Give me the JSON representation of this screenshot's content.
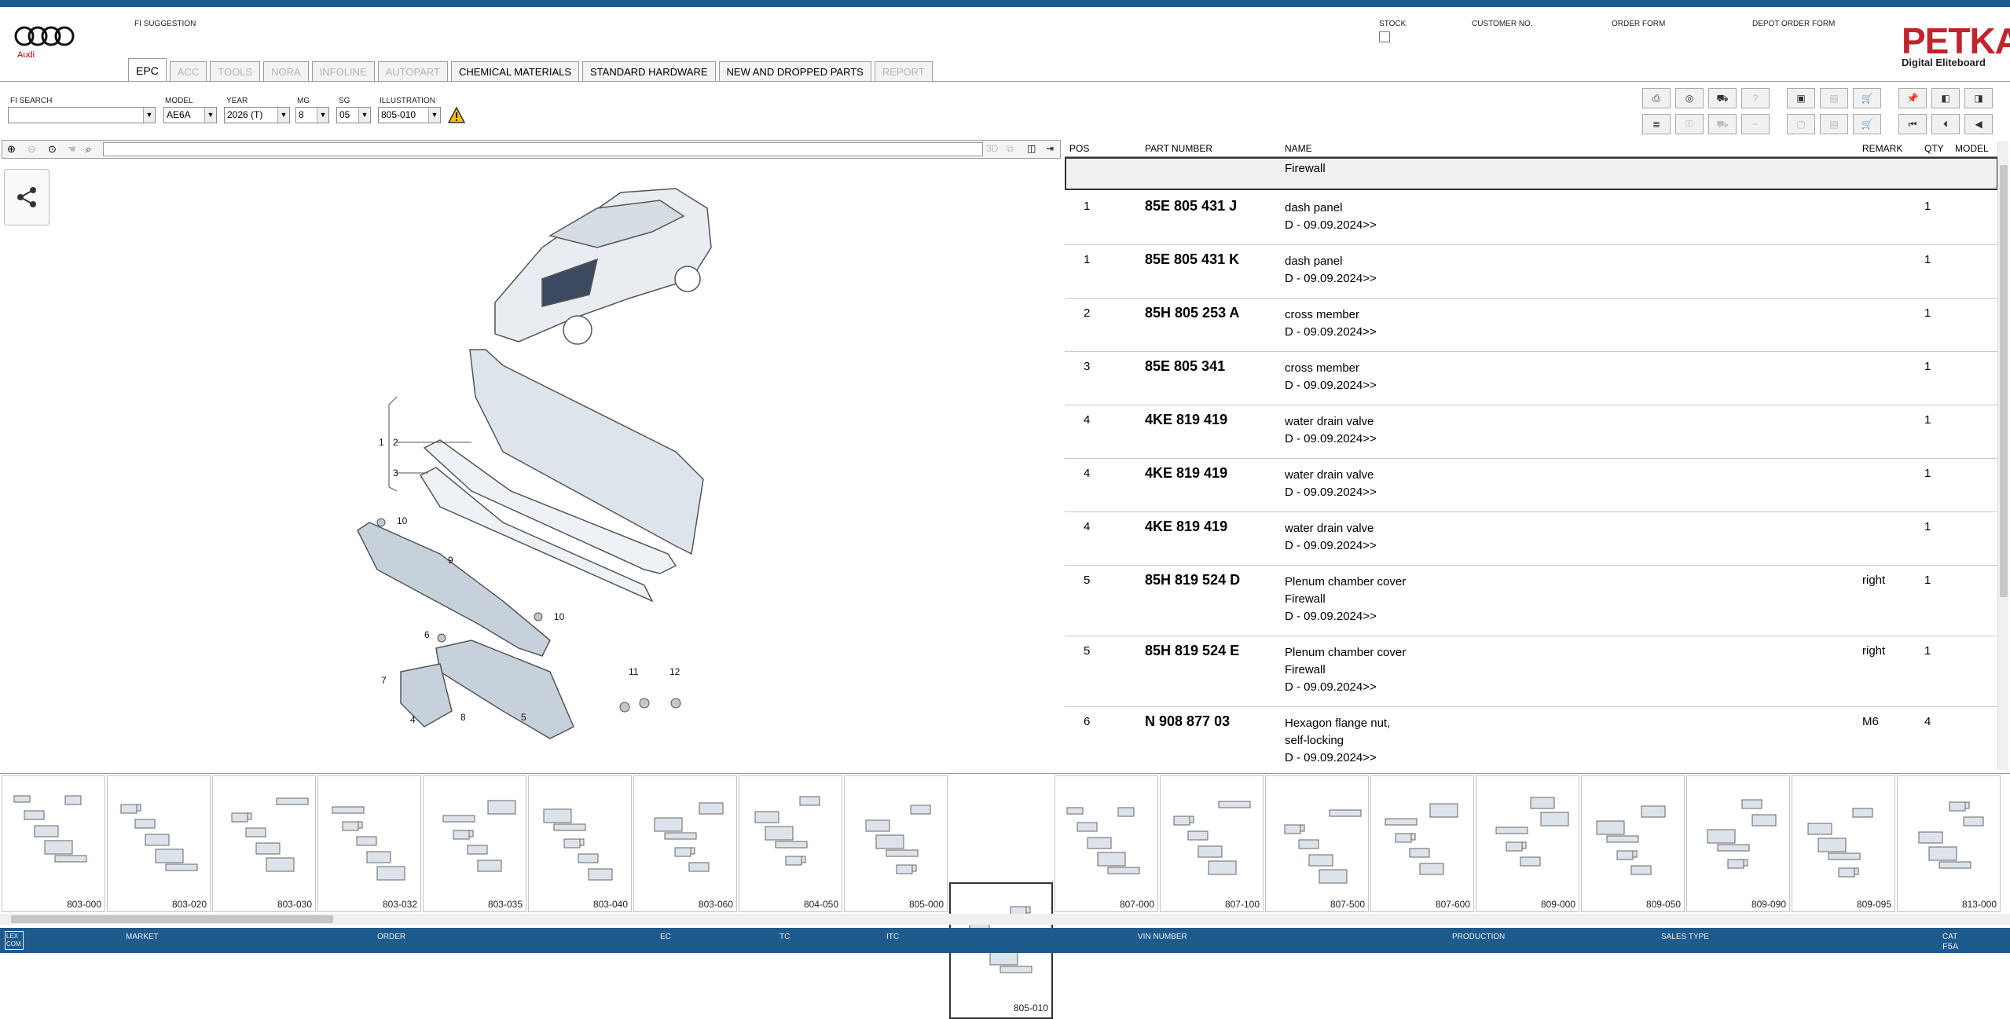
{
  "header": {
    "logo_text": "Audi",
    "fi_suggestion_label": "FI SUGGESTION",
    "stock_label": "STOCK",
    "customer_no_label": "CUSTOMER NO.",
    "order_form_label": "ORDER FORM",
    "depot_order_form_label": "DEPOT ORDER FORM",
    "petka_title": "PETKA",
    "petka_sub": "Digital Eliteboard"
  },
  "tabs": [
    {
      "label": "EPC",
      "state": "active"
    },
    {
      "label": "ACC",
      "state": "disabled"
    },
    {
      "label": "TOOLS",
      "state": "disabled"
    },
    {
      "label": "NORA",
      "state": "disabled"
    },
    {
      "label": "INFOLINE",
      "state": "disabled"
    },
    {
      "label": "AUTOPART",
      "state": "disabled"
    },
    {
      "label": "CHEMICAL MATERIALS",
      "state": "normal"
    },
    {
      "label": "STANDARD HARDWARE",
      "state": "normal"
    },
    {
      "label": "NEW AND DROPPED PARTS",
      "state": "normal"
    },
    {
      "label": "REPORT",
      "state": "disabled"
    }
  ],
  "filters": {
    "fi_search_label": "FI SEARCH",
    "fi_search_value": "",
    "model_label": "MODEL",
    "model_value": "AE6A",
    "year_label": "YEAR",
    "year_value": "2026 (T)",
    "mg_label": "MG",
    "mg_value": "8",
    "sg_label": "SG",
    "sg_value": "05",
    "illustration_label": "ILLUSTRATION",
    "illustration_value": "805-010"
  },
  "table": {
    "headers": {
      "pos": "POS",
      "part": "PART NUMBER",
      "name": "NAME",
      "remark": "REMARK",
      "qty": "QTY",
      "model": "MODEL"
    },
    "group_title": "Firewall",
    "rows": [
      {
        "pos": "1",
        "part": "85E 805 431 J",
        "name": [
          "dash panel",
          "D - 09.09.2024>>"
        ],
        "remark": "",
        "qty": "1"
      },
      {
        "pos": "1",
        "part": "85E 805 431 K",
        "name": [
          "dash panel",
          "D - 09.09.2024>>"
        ],
        "remark": "",
        "qty": "1"
      },
      {
        "pos": "2",
        "part": "85H 805 253 A",
        "name": [
          "cross member",
          "D - 09.09.2024>>"
        ],
        "remark": "",
        "qty": "1"
      },
      {
        "pos": "3",
        "part": "85E 805 341",
        "name": [
          "cross member",
          "D - 09.09.2024>>"
        ],
        "remark": "",
        "qty": "1"
      },
      {
        "pos": "4",
        "part": "4KE 819 419",
        "name": [
          "water drain valve",
          "D - 09.09.2024>>"
        ],
        "remark": "",
        "qty": "1"
      },
      {
        "pos": "4",
        "part": "4KE 819 419",
        "name": [
          "water drain valve",
          "D - 09.09.2024>>"
        ],
        "remark": "",
        "qty": "1"
      },
      {
        "pos": "4",
        "part": "4KE 819 419",
        "name": [
          "water drain valve",
          "D - 09.09.2024>>"
        ],
        "remark": "",
        "qty": "1"
      },
      {
        "pos": "5",
        "part": "85H 819 524 D",
        "name": [
          "Plenum chamber cover",
          "Firewall",
          "D - 09.09.2024>>"
        ],
        "remark": "right",
        "qty": "1"
      },
      {
        "pos": "5",
        "part": "85H 819 524 E",
        "name": [
          "Plenum chamber cover",
          "Firewall",
          "D - 09.09.2024>>"
        ],
        "remark": "right",
        "qty": "1"
      },
      {
        "pos": "6",
        "part": "N   908 877 03",
        "name": [
          "Hexagon flange nut,",
          "self-locking",
          "D - 09.09.2024>>"
        ],
        "remark": "M6",
        "qty": "4"
      }
    ]
  },
  "drawing": {
    "callouts": [
      "1",
      "2",
      "3",
      "10",
      "9",
      "10",
      "6",
      "7",
      "4",
      "8",
      "5",
      "11",
      "12"
    ]
  },
  "thumbnails": [
    {
      "label": "803-000"
    },
    {
      "label": "803-020"
    },
    {
      "label": "803-030"
    },
    {
      "label": "803-032"
    },
    {
      "label": "803-035"
    },
    {
      "label": "803-040"
    },
    {
      "label": "803-060"
    },
    {
      "label": "804-050"
    },
    {
      "label": "805-000"
    },
    {
      "label": "805-010",
      "selected": true
    },
    {
      "label": "807-000"
    },
    {
      "label": "807-100"
    },
    {
      "label": "807-500"
    },
    {
      "label": "807-600"
    },
    {
      "label": "809-000"
    },
    {
      "label": "809-050"
    },
    {
      "label": "809-090"
    },
    {
      "label": "809-095"
    },
    {
      "label": "813-000"
    }
  ],
  "statusbar": {
    "lex": "LEX\nCOM",
    "market": "MARKET",
    "order": "ORDER",
    "ec": "EC",
    "tc": "TC",
    "itc": "ITC",
    "vin": "VIN NUMBER",
    "production": "PRODUCTION",
    "sales_type": "SALES TYPE",
    "cat_label": "CAT",
    "cat_value": "F5A"
  },
  "colors": {
    "accent": "#1f5a8c",
    "petka_red": "#c0252c",
    "audi_red": "#b00000"
  }
}
